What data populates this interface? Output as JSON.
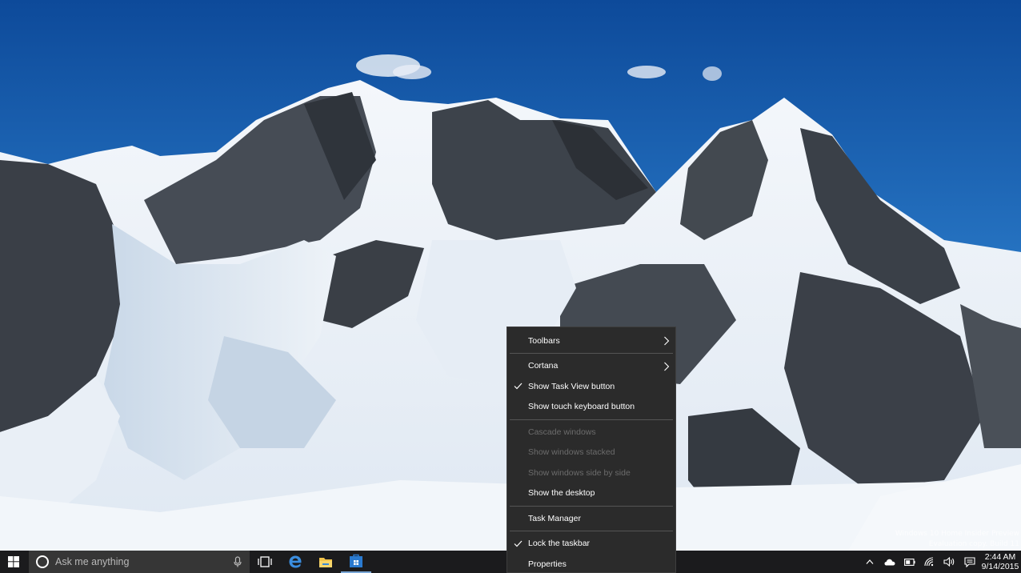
{
  "desktop": {
    "wallpaper": "snowy-mountain-landscape",
    "watermark": {
      "line1": "Windows 10 Home Insider Preview",
      "line2": "Evaluation copy. Build 11"
    }
  },
  "taskbar": {
    "search": {
      "placeholder": "Ask me anything"
    },
    "pinned": [
      "task-view",
      "edge",
      "file-explorer",
      "store"
    ],
    "tray": {
      "time": "2:44 AM",
      "date": "9/14/2015"
    },
    "colors": {
      "background": "#1b1b1d",
      "search_box": "#363636",
      "accent": "#7aa7d6"
    }
  },
  "context_menu": {
    "items": [
      {
        "label": "Toolbars",
        "submenu": true
      },
      {
        "label": "Cortana",
        "submenu": true
      },
      {
        "label": "Show Task View button",
        "checked": true
      },
      {
        "label": "Show touch keyboard button"
      },
      {
        "label": "Cascade windows",
        "disabled": true
      },
      {
        "label": "Show windows stacked",
        "disabled": true
      },
      {
        "label": "Show windows side by side",
        "disabled": true
      },
      {
        "label": "Show the desktop"
      },
      {
        "label": "Task Manager"
      },
      {
        "label": "Lock the taskbar",
        "checked": true
      },
      {
        "label": "Properties"
      }
    ],
    "colors": {
      "background": "#2b2b2b",
      "disabled_text": "#6c6c6c"
    }
  }
}
